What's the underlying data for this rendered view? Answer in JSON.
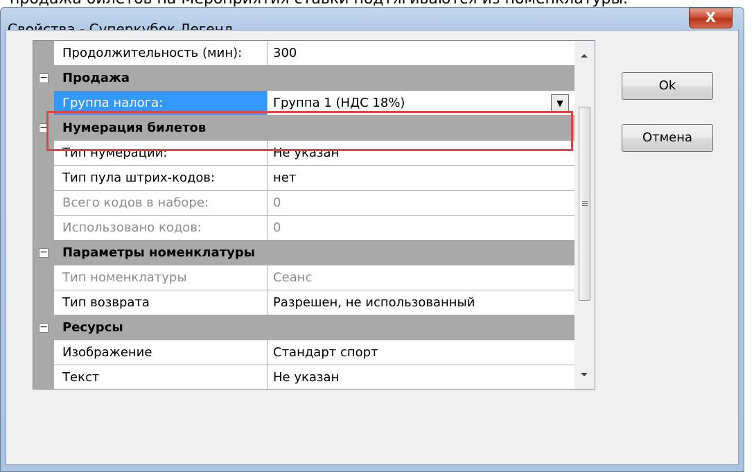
{
  "background_text": "продажа билетов на Мероприятия ставки подтягиваются из номенклатуры.",
  "window": {
    "title": "Свойства - Суперкубок Легенд",
    "close_symbol": "X"
  },
  "grid": {
    "rows": [
      {
        "kind": "prop",
        "label": "Продолжительность (мин):",
        "value": "300"
      },
      {
        "kind": "cat",
        "label": "Продажа"
      },
      {
        "kind": "prop",
        "label": "Группа налога:",
        "value": "Группа 1 (НДС 18%)"
      },
      {
        "kind": "cat",
        "label": "Нумерация билетов"
      },
      {
        "kind": "prop",
        "label": "Тип нумерации:",
        "value": "Не указан"
      },
      {
        "kind": "prop",
        "label": "Тип пула штрих-кодов:",
        "value": "нет"
      },
      {
        "kind": "prop",
        "label": "Всего кодов в наборе:",
        "value": "0"
      },
      {
        "kind": "prop",
        "label": "Использовано кодов:",
        "value": "0"
      },
      {
        "kind": "cat",
        "label": "Параметры номенклатуры"
      },
      {
        "kind": "prop",
        "label": "Тип номенклатуры",
        "value": "Сеанс"
      },
      {
        "kind": "prop",
        "label": "Тип возврата",
        "value": "Разрешен, не использованный"
      },
      {
        "kind": "cat",
        "label": "Ресурсы"
      },
      {
        "kind": "prop",
        "label": "Изображение",
        "value": "Стандарт спорт"
      },
      {
        "kind": "prop",
        "label": "Текст",
        "value": "Не указан"
      }
    ],
    "collapse_symbol": "−",
    "dropdown_symbol": "▼"
  },
  "buttons": {
    "ok": "Ok",
    "cancel": "Отмена"
  },
  "colors": {
    "selection": "#3399ff",
    "highlight_box": "#e04545",
    "category_band": "#a9a9a9"
  }
}
